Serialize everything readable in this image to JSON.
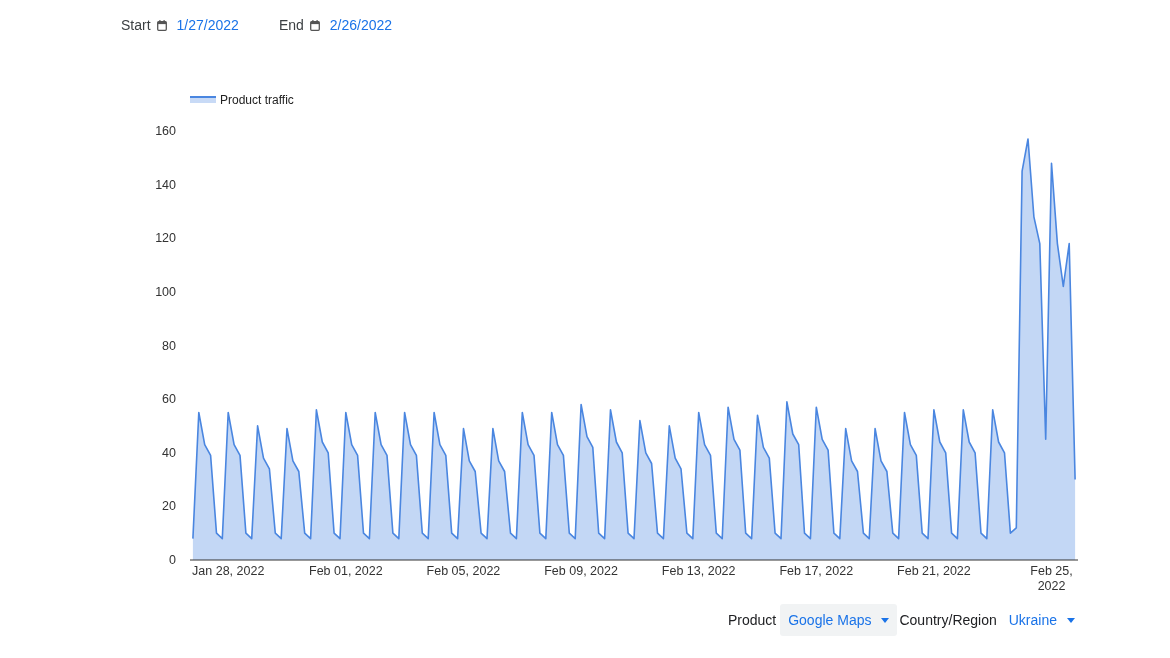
{
  "date_range": {
    "start": {
      "label": "Start",
      "value": "1/27/2022"
    },
    "end": {
      "label": "End",
      "value": "2/26/2022"
    }
  },
  "chart": {
    "chart_data": {
      "type": "area",
      "ylim": [
        0,
        160
      ],
      "yticks": [
        0,
        20,
        40,
        60,
        80,
        100,
        120,
        140,
        160
      ],
      "categories": [
        null,
        null,
        null,
        null,
        null,
        null,
        "Jan 28, 2022",
        null,
        null,
        null,
        null,
        null,
        null,
        null,
        null,
        null,
        null,
        null,
        null,
        null,
        null,
        null,
        null,
        null,
        null,
        null,
        "Feb 01, 2022",
        null,
        null,
        null,
        null,
        null,
        null,
        null,
        null,
        null,
        null,
        null,
        null,
        null,
        null,
        null,
        null,
        null,
        null,
        null,
        "Feb 05, 2022",
        null,
        null,
        null,
        null,
        null,
        null,
        null,
        null,
        null,
        null,
        null,
        null,
        null,
        null,
        null,
        null,
        null,
        null,
        null,
        "Feb 09, 2022",
        null,
        null,
        null,
        null,
        null,
        null,
        null,
        null,
        null,
        null,
        null,
        null,
        null,
        null,
        null,
        null,
        null,
        null,
        null,
        "Feb 13, 2022",
        null,
        null,
        null,
        null,
        null,
        null,
        null,
        null,
        null,
        null,
        null,
        null,
        null,
        null,
        null,
        null,
        null,
        null,
        null,
        "Feb 17, 2022",
        null,
        null,
        null,
        null,
        null,
        null,
        null,
        null,
        null,
        null,
        null,
        null,
        null,
        null,
        null,
        null,
        null,
        null,
        null,
        "Feb 21, 2022",
        null,
        null,
        null,
        null,
        null,
        null,
        null,
        null,
        null,
        null,
        null,
        null,
        null,
        null,
        null,
        null,
        null,
        null,
        null,
        "Feb 25, 2022",
        null,
        null,
        null,
        null
      ],
      "series": [
        {
          "name": "Product traffic",
          "color": "#4a86e0",
          "values": [
            8,
            55,
            43,
            39,
            10,
            8,
            55,
            43,
            39,
            10,
            8,
            50,
            38,
            34,
            10,
            8,
            49,
            37,
            33,
            10,
            8,
            56,
            44,
            40,
            10,
            8,
            55,
            43,
            39,
            10,
            8,
            55,
            43,
            39,
            10,
            8,
            55,
            43,
            39,
            10,
            8,
            55,
            43,
            39,
            10,
            8,
            49,
            37,
            33,
            10,
            8,
            49,
            37,
            33,
            10,
            8,
            55,
            43,
            39,
            10,
            8,
            55,
            43,
            39,
            10,
            8,
            58,
            46,
            42,
            10,
            8,
            56,
            44,
            40,
            10,
            8,
            52,
            40,
            36,
            10,
            8,
            50,
            38,
            34,
            10,
            8,
            55,
            43,
            39,
            10,
            8,
            57,
            45,
            41,
            10,
            8,
            54,
            42,
            38,
            10,
            8,
            59,
            47,
            43,
            10,
            8,
            57,
            45,
            41,
            10,
            8,
            49,
            37,
            33,
            10,
            8,
            49,
            37,
            33,
            10,
            8,
            55,
            43,
            39,
            10,
            8,
            56,
            44,
            40,
            10,
            8,
            56,
            44,
            40,
            10,
            8,
            56,
            44,
            40,
            10,
            12,
            145,
            157,
            128,
            118,
            45,
            148,
            118,
            102,
            118,
            30
          ]
        }
      ]
    }
  },
  "filters": [
    {
      "label": "Product",
      "value": "Google Maps",
      "highlighted": true
    },
    {
      "label": "Country/Region",
      "value": "Ukraine",
      "highlighted": false
    }
  ]
}
